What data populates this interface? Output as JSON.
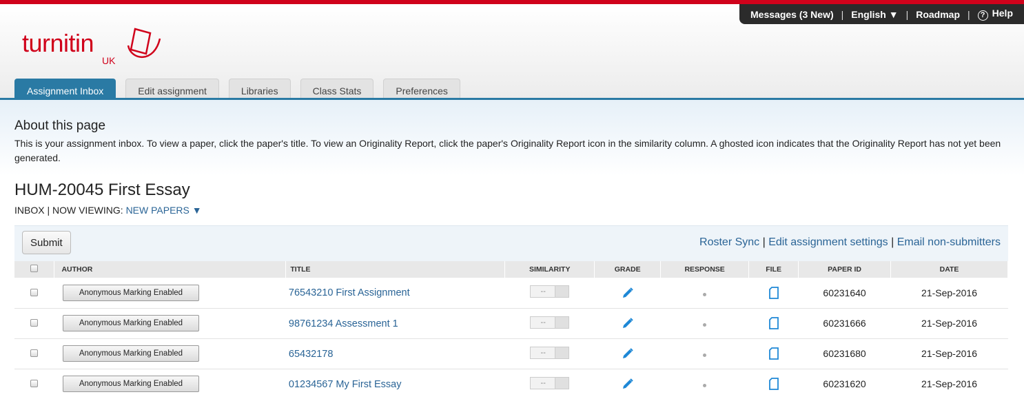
{
  "topnav": {
    "messages": "Messages (3 New)",
    "language": "English ▼",
    "roadmap": "Roadmap",
    "help": "Help",
    "separator": "|"
  },
  "logo": {
    "text": "turnitin",
    "region": "UK"
  },
  "tabs": [
    {
      "label": "Assignment Inbox",
      "active": true
    },
    {
      "label": "Edit assignment",
      "active": false
    },
    {
      "label": "Libraries",
      "active": false
    },
    {
      "label": "Class Stats",
      "active": false
    },
    {
      "label": "Preferences",
      "active": false
    }
  ],
  "about": {
    "heading": "About this page",
    "text": "This is your assignment inbox. To view a paper, click the paper's title. To view an Originality Report, click the paper's Originality Report icon in the similarity column. A ghosted icon indicates that the Originality Report has not yet been generated."
  },
  "assignment": {
    "title": "HUM-20045 First Essay",
    "inbox": "INBOX",
    "now_viewing_label": "| NOW VIEWING:",
    "now_viewing_value": "NEW PAPERS ▼"
  },
  "toolbar": {
    "submit": "Submit",
    "roster_sync": "Roster Sync",
    "edit_settings": "Edit assignment settings",
    "email_non_submitters": "Email non-submitters",
    "separator": "|"
  },
  "table": {
    "headers": {
      "author": "AUTHOR",
      "title": "TITLE",
      "similarity": "SIMILARITY",
      "grade": "GRADE",
      "response": "RESPONSE",
      "file": "FILE",
      "paper_id": "PAPER ID",
      "date": "DATE"
    },
    "rows": [
      {
        "author": "Anonymous Marking Enabled",
        "title": "76543210 First Assignment",
        "similarity": "--",
        "paper_id": "60231640",
        "date": "21-Sep-2016"
      },
      {
        "author": "Anonymous Marking Enabled",
        "title": "98761234 Assessment 1",
        "similarity": "--",
        "paper_id": "60231666",
        "date": "21-Sep-2016"
      },
      {
        "author": "Anonymous Marking Enabled",
        "title": "65432178",
        "similarity": "--",
        "paper_id": "60231680",
        "date": "21-Sep-2016"
      },
      {
        "author": "Anonymous Marking Enabled",
        "title": "01234567 My First Essay",
        "similarity": "--",
        "paper_id": "60231620",
        "date": "21-Sep-2016"
      }
    ]
  },
  "colors": {
    "brand_red": "#d0021b",
    "tab_active": "#2a7aa4",
    "link": "#2a6496",
    "icon_blue": "#1e88d6"
  }
}
